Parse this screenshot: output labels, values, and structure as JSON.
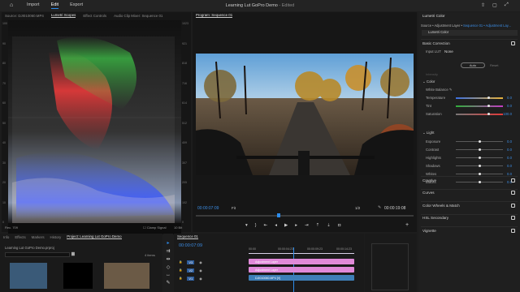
{
  "menu": {
    "items": [
      "Import",
      "Edit",
      "Export"
    ],
    "active_index": 1
  },
  "app_title": {
    "name": "Learning Lut GoPro Demo",
    "status": "- Edited"
  },
  "scopes_panel": {
    "tabs": [
      "Source: DJI010060.MP4",
      "Lumetri Scopes",
      "Effect Controls",
      "Audio Clip Mixer: Sequence 01"
    ],
    "active_tab": 1,
    "left_scale": [
      "100",
      "90",
      "80",
      "70",
      "60",
      "50",
      "40",
      "30",
      "20",
      "10",
      "0"
    ],
    "right_scale": [
      "1023",
      "921",
      "818",
      "716",
      "614",
      "512",
      "409",
      "307",
      "205",
      "102",
      "0"
    ],
    "bottom": {
      "rec": "Rec. 709",
      "clamp_label": "Clamp Signal",
      "bit_depth": "10 Bit"
    }
  },
  "program": {
    "tab": "Program: Sequence 01",
    "timecode": "00:00:07:09",
    "fit": "Fit",
    "quality": "1/2",
    "duration": "00:00:19:08"
  },
  "lumetri": {
    "panel_title": "Lumetri Color",
    "source": "Source • Adjustment Layer",
    "target": "Sequence 01 • Adjustment Lay...",
    "effect": "Lumetri Color",
    "basic_correction": "Basic Correction",
    "input_lut_label": "Input LUT",
    "input_lut_value": "None",
    "auto_label": "Auto",
    "reset_label": "Reset",
    "intensity_label": "Intensity",
    "color_label": "Color",
    "white_balance": "White Balance",
    "color_rows": [
      {
        "label": "Temperature",
        "value": "0.0",
        "pos": 0.7
      },
      {
        "label": "Tint",
        "value": "0.0",
        "pos": 0.7
      },
      {
        "label": "Saturation",
        "value": "100.0",
        "pos": 0.7
      }
    ],
    "light_label": "Light",
    "light_rows": [
      {
        "label": "Exposure",
        "value": "0.0",
        "pos": 0.5
      },
      {
        "label": "Contrast",
        "value": "0.0",
        "pos": 0.5
      },
      {
        "label": "Highlights",
        "value": "0.0",
        "pos": 0.5
      },
      {
        "label": "Shadows",
        "value": "0.0",
        "pos": 0.5
      },
      {
        "label": "Whites",
        "value": "0.0",
        "pos": 0.5
      },
      {
        "label": "Blacks",
        "value": "0.0",
        "pos": 0.5
      }
    ],
    "sections": [
      "Creative",
      "Curves",
      "Color Wheels & Match",
      "HSL Secondary",
      "Vignette"
    ]
  },
  "project": {
    "tabs": [
      "Info",
      "Effects",
      "Markers",
      "History",
      "Project: Learning Lut GoPro Demo"
    ],
    "active_tab": 4,
    "path": "Learning Lut GoPro Demo.prproj",
    "items_count": "4 items"
  },
  "timeline": {
    "tab": "Sequence 01",
    "timecode": "00:00:07:09",
    "ruler": [
      "00:00",
      "00:00:04:23",
      "00:00:09:23",
      "00:00:14:23"
    ],
    "tracks": [
      "V3",
      "V2",
      "V1"
    ],
    "clips": [
      {
        "label": "Adjustment Layer",
        "color": "#e089d8"
      },
      {
        "label": "Adjustment Layer",
        "color": "#e089d8"
      },
      {
        "label": "DJI010060.MP4 [V]",
        "color": "#3e7fb8"
      }
    ]
  },
  "colors": {
    "accent": "#2d8ceb",
    "timecode": "#3c8de4",
    "adjustment": "#e089d8",
    "video_clip": "#3e7fb8"
  }
}
